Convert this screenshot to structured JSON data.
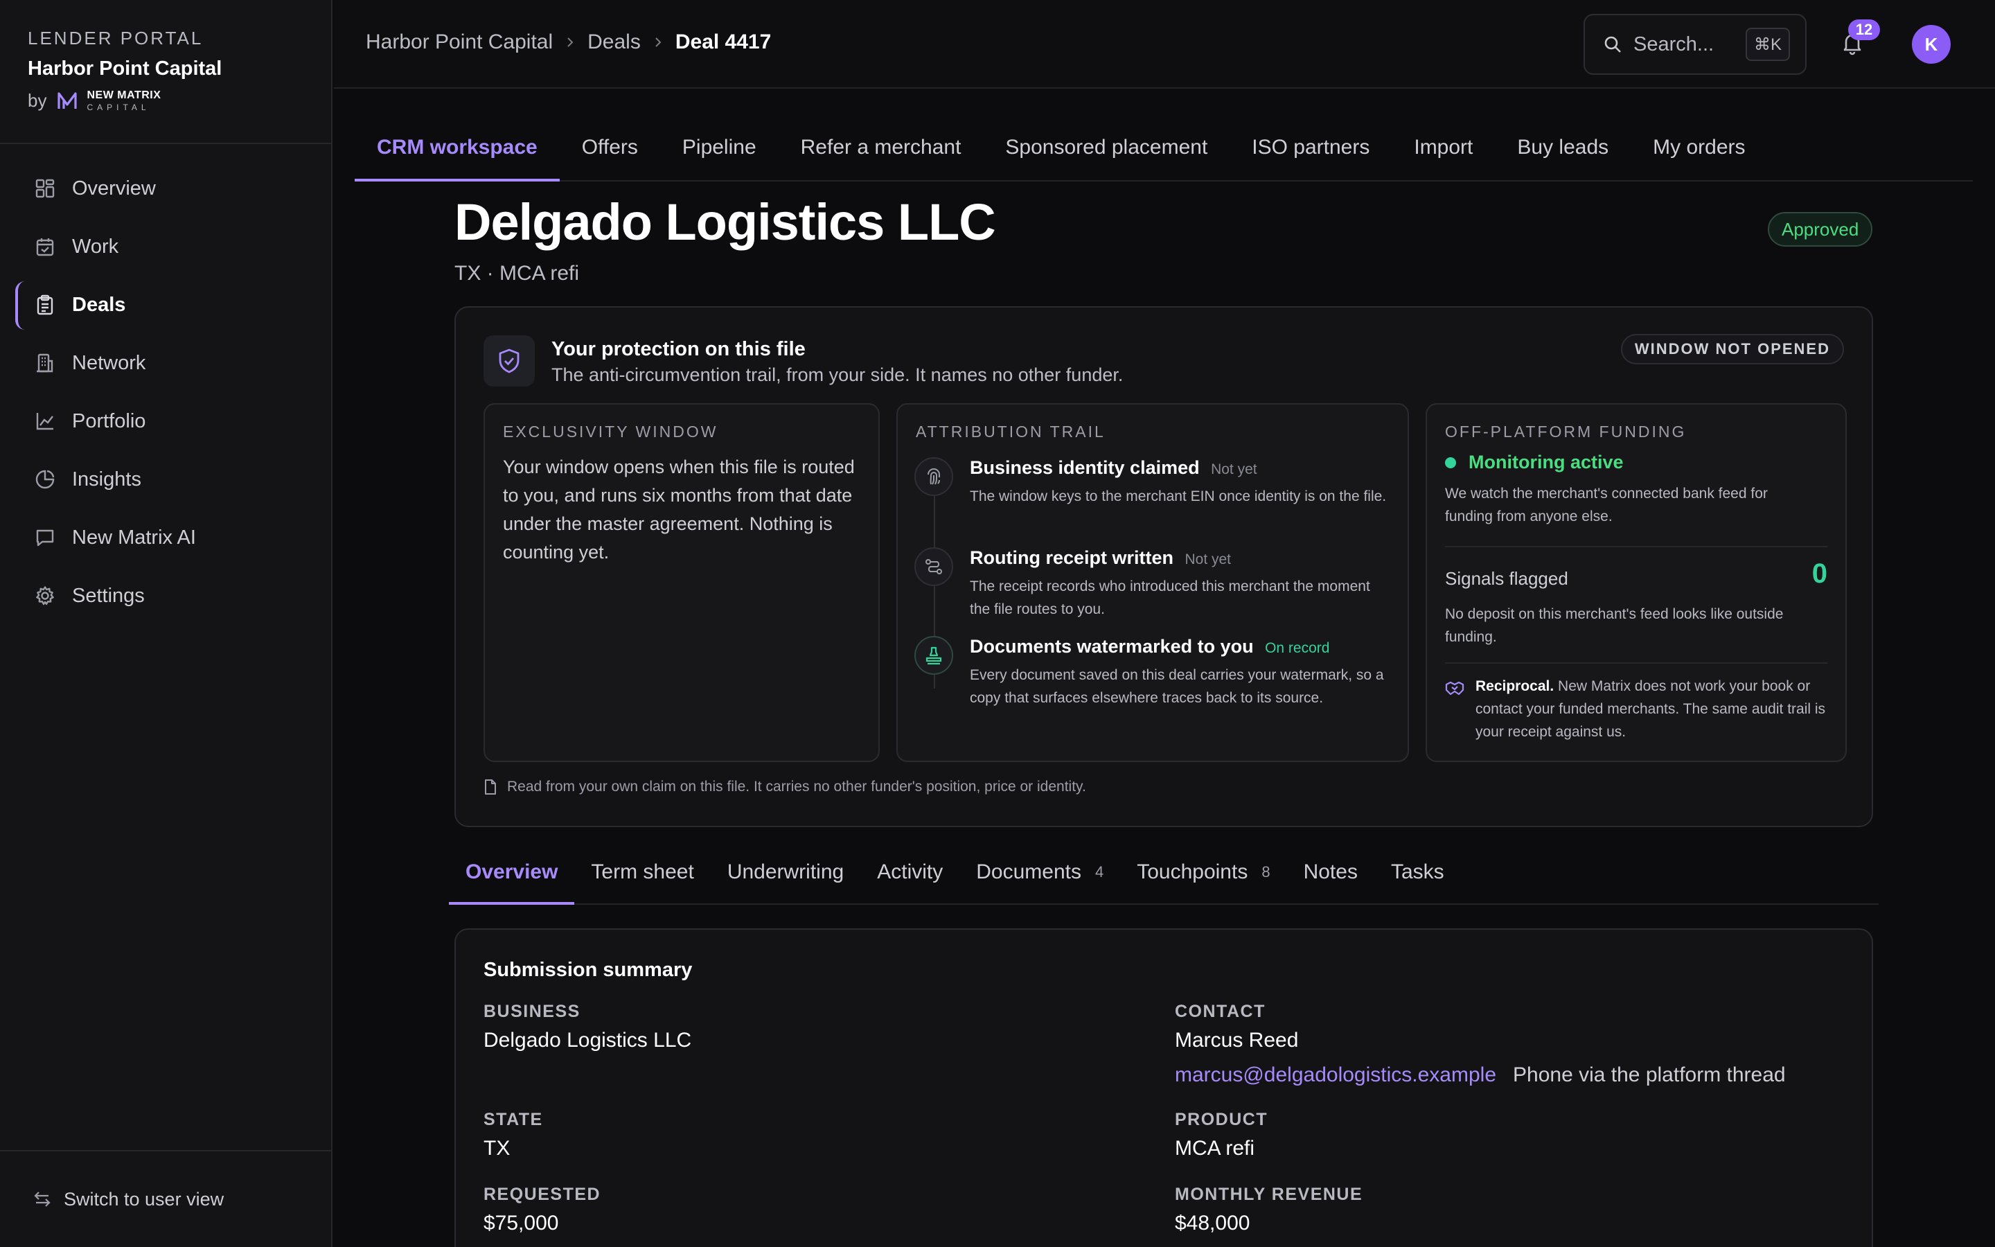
{
  "sidebar": {
    "kicker": "LENDER PORTAL",
    "org_name": "Harbor Point Capital",
    "by_label": "by",
    "logo_line1": "NEW MATRIX",
    "logo_line2": "CAPITAL",
    "items": [
      {
        "label": "Overview",
        "icon": "grid-icon"
      },
      {
        "label": "Work",
        "icon": "calendar-check-icon"
      },
      {
        "label": "Deals",
        "icon": "clipboard-icon",
        "active": true
      },
      {
        "label": "Network",
        "icon": "building-icon"
      },
      {
        "label": "Portfolio",
        "icon": "line-chart-icon"
      },
      {
        "label": "Insights",
        "icon": "pie-chart-icon"
      },
      {
        "label": "New Matrix AI",
        "icon": "chat-icon"
      },
      {
        "label": "Settings",
        "icon": "gear-icon"
      }
    ],
    "switch_view": "Switch to user view"
  },
  "topbar": {
    "breadcrumbs": [
      "Harbor Point Capital",
      "Deals",
      "Deal 4417"
    ],
    "search_placeholder": "Search...",
    "search_shortcut": "⌘K",
    "notification_count": "12",
    "avatar_initial": "K"
  },
  "tabs": [
    "CRM workspace",
    "Offers",
    "Pipeline",
    "Refer a merchant",
    "Sponsored placement",
    "ISO partners",
    "Import",
    "Buy leads",
    "My orders"
  ],
  "deal": {
    "title": "Delgado Logistics LLC",
    "subtitle": "TX · MCA refi",
    "status": "Approved"
  },
  "protection": {
    "title": "Your protection on this file",
    "subtitle": "The anti-circumvention trail, from your side. It names no other funder.",
    "window_status": "WINDOW NOT OPENED",
    "exclusivity": {
      "kicker": "EXCLUSIVITY WINDOW",
      "text": "Your window opens when this file is routed to you, and runs six months from that date under the master agreement. Nothing is counting yet."
    },
    "attribution": {
      "kicker": "ATTRIBUTION TRAIL",
      "items": [
        {
          "title": "Business identity claimed",
          "status": "Not yet",
          "body": "The window keys to the merchant EIN once identity is on the file."
        },
        {
          "title": "Routing receipt written",
          "status": "Not yet",
          "body": "The receipt records who introduced this merchant the moment the file routes to you."
        },
        {
          "title": "Documents watermarked to you",
          "status": "On record",
          "body": "Every document saved on this deal carries your watermark, so a copy that surfaces elsewhere traces back to its source."
        }
      ]
    },
    "off_platform": {
      "kicker": "OFF-PLATFORM FUNDING",
      "monitor_label": "Monitoring active",
      "monitor_body": "We watch the merchant's connected bank feed for funding from anyone else.",
      "signals_label": "Signals flagged",
      "signals_count": "0",
      "signals_body": "No deposit on this merchant's feed looks like outside funding.",
      "reciprocal_label": "Reciprocal.",
      "reciprocal_body": " New Matrix does not work your book or contact your funded merchants. The same audit trail is your receipt against us."
    },
    "footer": "Read from your own claim on this file. It carries no other funder's position, price or identity."
  },
  "subtabs": [
    {
      "label": "Overview",
      "count": ""
    },
    {
      "label": "Term sheet",
      "count": ""
    },
    {
      "label": "Underwriting",
      "count": ""
    },
    {
      "label": "Activity",
      "count": ""
    },
    {
      "label": "Documents",
      "count": "4"
    },
    {
      "label": "Touchpoints",
      "count": "8"
    },
    {
      "label": "Notes",
      "count": ""
    },
    {
      "label": "Tasks",
      "count": ""
    }
  ],
  "summary": {
    "title": "Submission summary",
    "business_label": "BUSINESS",
    "business": "Delgado Logistics LLC",
    "contact_label": "CONTACT",
    "contact_name": "Marcus Reed",
    "contact_email": "marcus@delgadologistics.example",
    "contact_phone": "Phone via the platform thread",
    "state_label": "STATE",
    "state": "TX",
    "product_label": "PRODUCT",
    "product": "MCA refi",
    "requested_label": "REQUESTED",
    "requested": "$75,000",
    "revenue_label": "MONTHLY REVENUE",
    "revenue": "$48,000"
  }
}
